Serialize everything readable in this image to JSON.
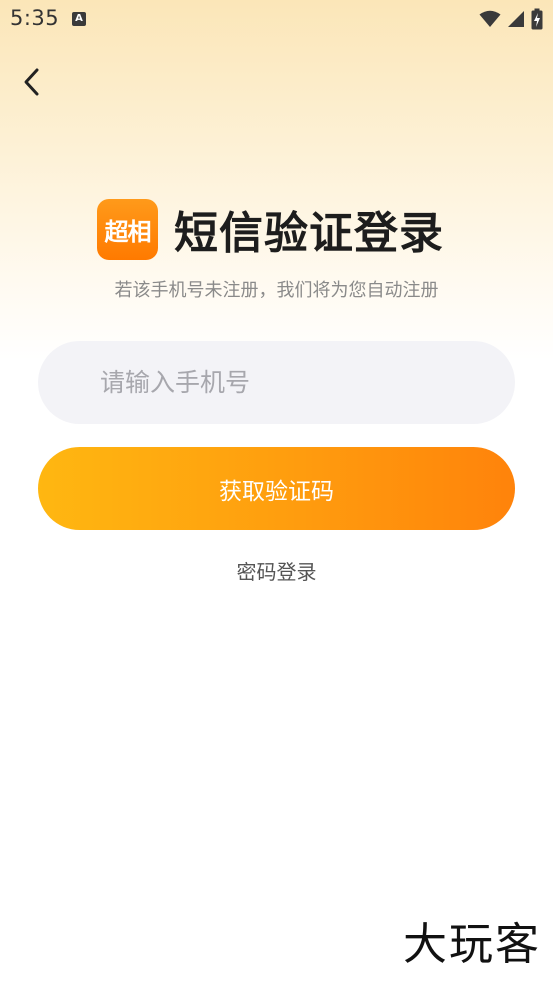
{
  "status_bar": {
    "time": "5:35",
    "notification_badge": "A",
    "icons": [
      "wifi-icon",
      "signal-icon",
      "battery-charging-icon"
    ]
  },
  "navigation": {
    "back_icon": "chevron-left-icon"
  },
  "header": {
    "logo_text": "超相",
    "title": "短信验证登录",
    "subtitle": "若该手机号未注册，我们将为您自动注册"
  },
  "form": {
    "phone_value": "",
    "phone_placeholder": "请输入手机号",
    "get_code_label": "获取验证码",
    "password_login_label": "密码登录"
  },
  "watermark": {
    "text": "大玩客"
  },
  "colors": {
    "accent_start": "#ffb711",
    "accent_end": "#ff830b",
    "logo": "#ff8a0d",
    "input_bg": "#f3f3f7"
  }
}
